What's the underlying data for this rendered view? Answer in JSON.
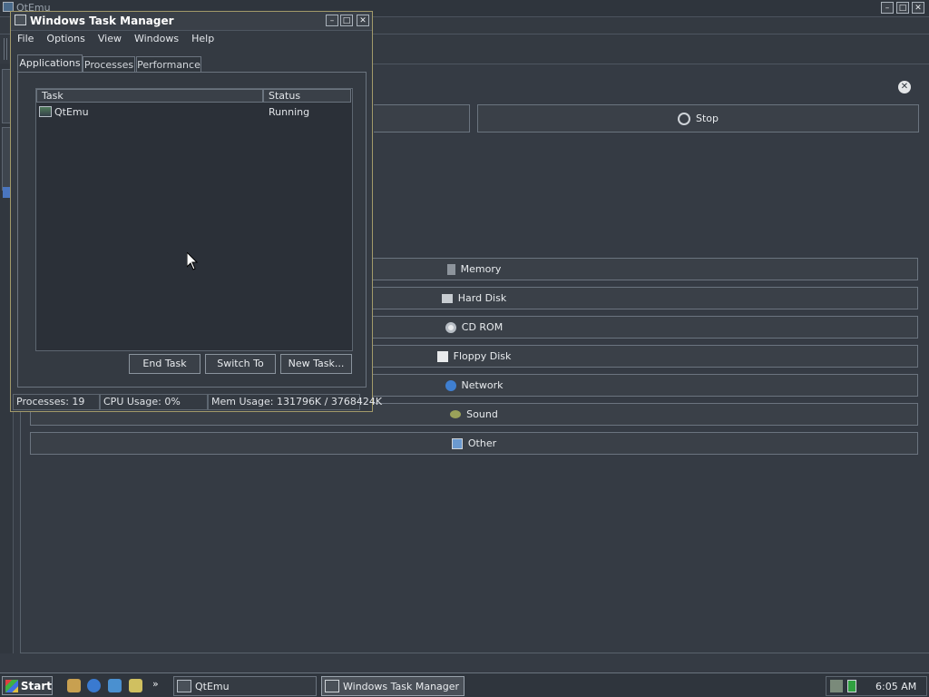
{
  "background_app": {
    "title": "QtEmu",
    "stop_label": "Stop",
    "sections": [
      "Memory",
      "Hard Disk",
      "CD ROM",
      "Floppy Disk",
      "Network",
      "Sound",
      "Other"
    ]
  },
  "task_manager": {
    "title": "Windows Task Manager",
    "menu": [
      "File",
      "Options",
      "View",
      "Windows",
      "Help"
    ],
    "tabs": [
      "Applications",
      "Processes",
      "Performance"
    ],
    "columns": [
      "Task",
      "Status"
    ],
    "tasks": [
      {
        "name": "QtEmu",
        "status": "Running"
      }
    ],
    "buttons": {
      "end_task": "End Task",
      "switch_to": "Switch To",
      "new_task": "New Task..."
    },
    "status": {
      "processes": "Processes: 19",
      "cpu": "CPU Usage: 0%",
      "mem": "Mem Usage: 131796K / 3768424K"
    }
  },
  "taskbar": {
    "start": "Start",
    "items": [
      "QtEmu",
      "Windows Task Manager"
    ],
    "clock": "6:05 AM"
  }
}
